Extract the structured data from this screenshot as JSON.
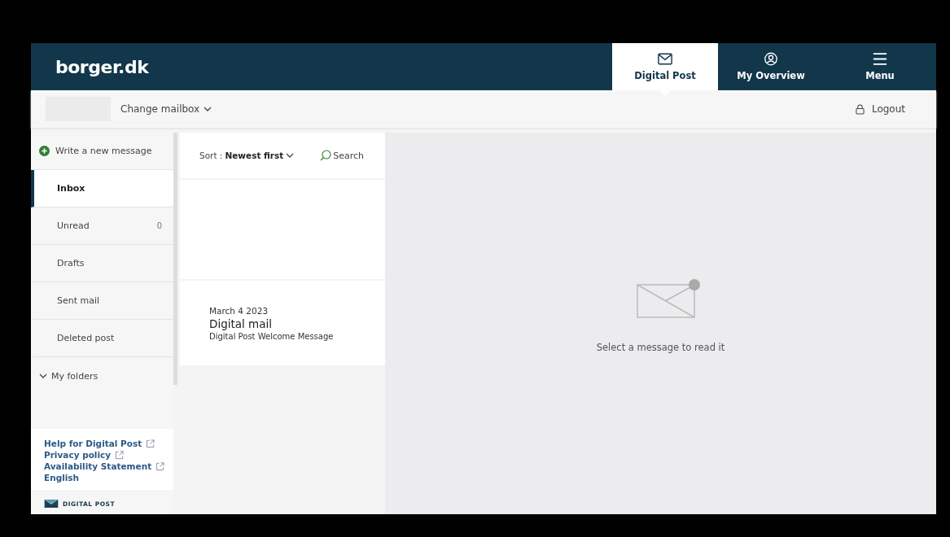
{
  "header": {
    "logo": "borger.dk",
    "tabs": [
      {
        "label": "Digital Post",
        "kind": "mail",
        "selected": true
      },
      {
        "label": "My Overview",
        "kind": "user",
        "selected": false
      },
      {
        "label": "Menu",
        "kind": "menu",
        "selected": false
      }
    ]
  },
  "subbar": {
    "change_mailbox": "Change mailbox",
    "logout": "Logout"
  },
  "sidebar": {
    "new_message": "Write a new message",
    "folders": [
      {
        "label": "Inbox",
        "selected": true
      },
      {
        "label": "Unread",
        "count": "0",
        "selected": false
      },
      {
        "label": "Drafts",
        "selected": false
      },
      {
        "label": "Sent mail",
        "selected": false
      },
      {
        "label": "Deleted post",
        "selected": false
      }
    ],
    "my_folders": {
      "label": "My folders",
      "expanded": true
    },
    "links": [
      {
        "label": "Help for Digital Post",
        "external": true
      },
      {
        "label": "Privacy policy",
        "external": true
      },
      {
        "label": "Availability Statement",
        "external": true
      },
      {
        "label": "English",
        "external": false
      }
    ],
    "brand": "DIGITAL POST"
  },
  "list": {
    "sort_label": "Sort : ",
    "sort_value": "Newest first",
    "search": "Search",
    "messages": [
      {
        "date": "March 4 2023",
        "sender": "Digital mail",
        "subject": "Digital Post Welcome Message"
      }
    ]
  },
  "reader": {
    "empty_text": "Select a message to read it"
  }
}
